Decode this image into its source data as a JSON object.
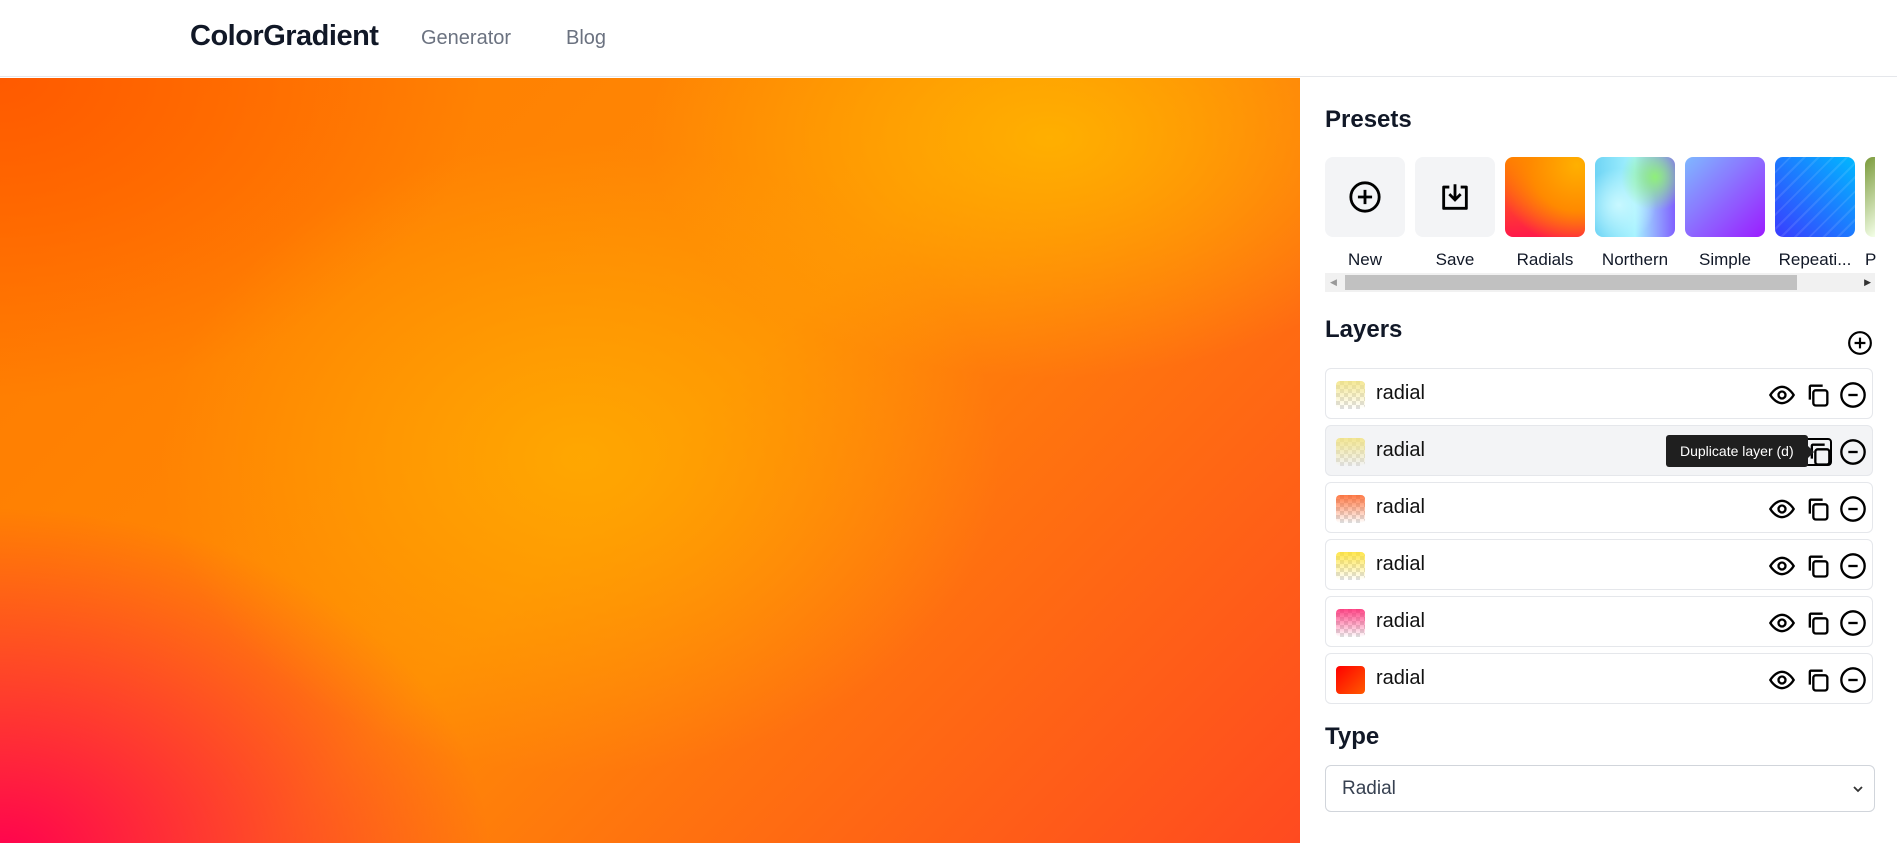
{
  "header": {
    "logo": "ColorGradient",
    "nav": [
      "Generator",
      "Blog"
    ]
  },
  "presets": {
    "title": "Presets",
    "items": [
      {
        "label": "New",
        "icon": "plus-circle-icon"
      },
      {
        "label": "Save",
        "icon": "download-box-icon"
      },
      {
        "label": "Radials",
        "colors": [
          "#ff1a4a",
          "#ff8a00",
          "#ffb000"
        ]
      },
      {
        "label": "Northern",
        "colors": [
          "#6fd4f5",
          "#a6f3ff",
          "#8fef7a",
          "#8060ff"
        ]
      },
      {
        "label": "Simple",
        "colors": [
          "#9b1cff",
          "#7fb8ff"
        ]
      },
      {
        "label": "Repeati...",
        "colors": [
          "#3a3cff",
          "#00b8ff"
        ]
      },
      {
        "label": "P",
        "colors": [
          "#f4ffe8",
          "#7a9a3a"
        ]
      }
    ]
  },
  "layers": {
    "title": "Layers",
    "items": [
      {
        "label": "radial",
        "color": "#f2e27a"
      },
      {
        "label": "radial",
        "color": "#f2e27a"
      },
      {
        "label": "radial",
        "color": "#ff5a1a"
      },
      {
        "label": "radial",
        "color": "#ffe020"
      },
      {
        "label": "radial",
        "color": "#ff1a6a"
      },
      {
        "label": "radial",
        "color": "#ff1a00"
      }
    ],
    "tooltip": "Duplicate layer (d)"
  },
  "type": {
    "title": "Type",
    "selected": "Radial"
  }
}
